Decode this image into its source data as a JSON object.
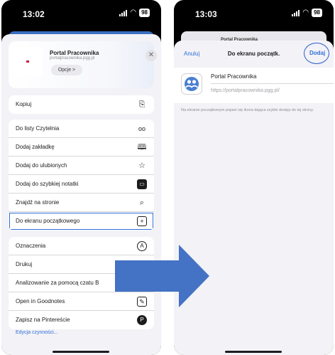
{
  "left_phone": {
    "status": {
      "time": "13:02",
      "battery": "98"
    },
    "site": {
      "title": "Portal Pracownika",
      "url": "portalpracownika.pgg.pl",
      "options_label": "Opcje >"
    },
    "groups": [
      [
        {
          "label": "Kopiuj",
          "icon": "copy-icon",
          "glyph": "⎘"
        }
      ],
      [
        {
          "label": "Do listy Czytelnia",
          "icon": "glasses-icon",
          "glyph": "oo"
        },
        {
          "label": "Dodaj zakładkę",
          "icon": "book-icon",
          "glyph": "🕮"
        },
        {
          "label": "Dodaj do ulubionych",
          "icon": "star-icon",
          "glyph": "☆"
        },
        {
          "label": "Dodaj do szybkiej notatki",
          "icon": "quick-note-icon",
          "glyph": "▭"
        },
        {
          "label": "Znajdź na stronie",
          "icon": "find-on-page-icon",
          "glyph": "⌕"
        },
        {
          "label": "Do ekranu początkowego",
          "icon": "add-square-icon",
          "glyph": "+"
        }
      ],
      [
        {
          "label": "Oznaczenia",
          "icon": "markup-icon",
          "glyph": "A"
        },
        {
          "label": "Drukuj",
          "icon": "printer-icon",
          "glyph": "⎙"
        },
        {
          "label": "Analizowanie za pomocą czatu B",
          "icon": "chat-icon",
          "glyph": ""
        },
        {
          "label": "Open in Goodnotes",
          "icon": "goodnotes-icon",
          "glyph": "✎"
        },
        {
          "label": "Zapisz na Pintereście",
          "icon": "pinterest-icon",
          "glyph": "P"
        }
      ]
    ],
    "edit_actions_label": "Edycja czynności..."
  },
  "right_phone": {
    "status": {
      "time": "13:03",
      "battery": "98"
    },
    "peek_title": "Portal Pracownika",
    "nav": {
      "cancel": "Anuluj",
      "title": "Do ekranu początk.",
      "add": "Dodaj"
    },
    "app": {
      "name": "Portal Pracownika",
      "url": "https://portalpracownika.pgg.pl/"
    },
    "note": "Na ekranie początkowym pojawi się ikona dająca szybki dostęp do tej strony."
  },
  "colors": {
    "accent": "#2f6fd6",
    "arrow": "#4472c4",
    "sheet": "#f2f2f7"
  }
}
